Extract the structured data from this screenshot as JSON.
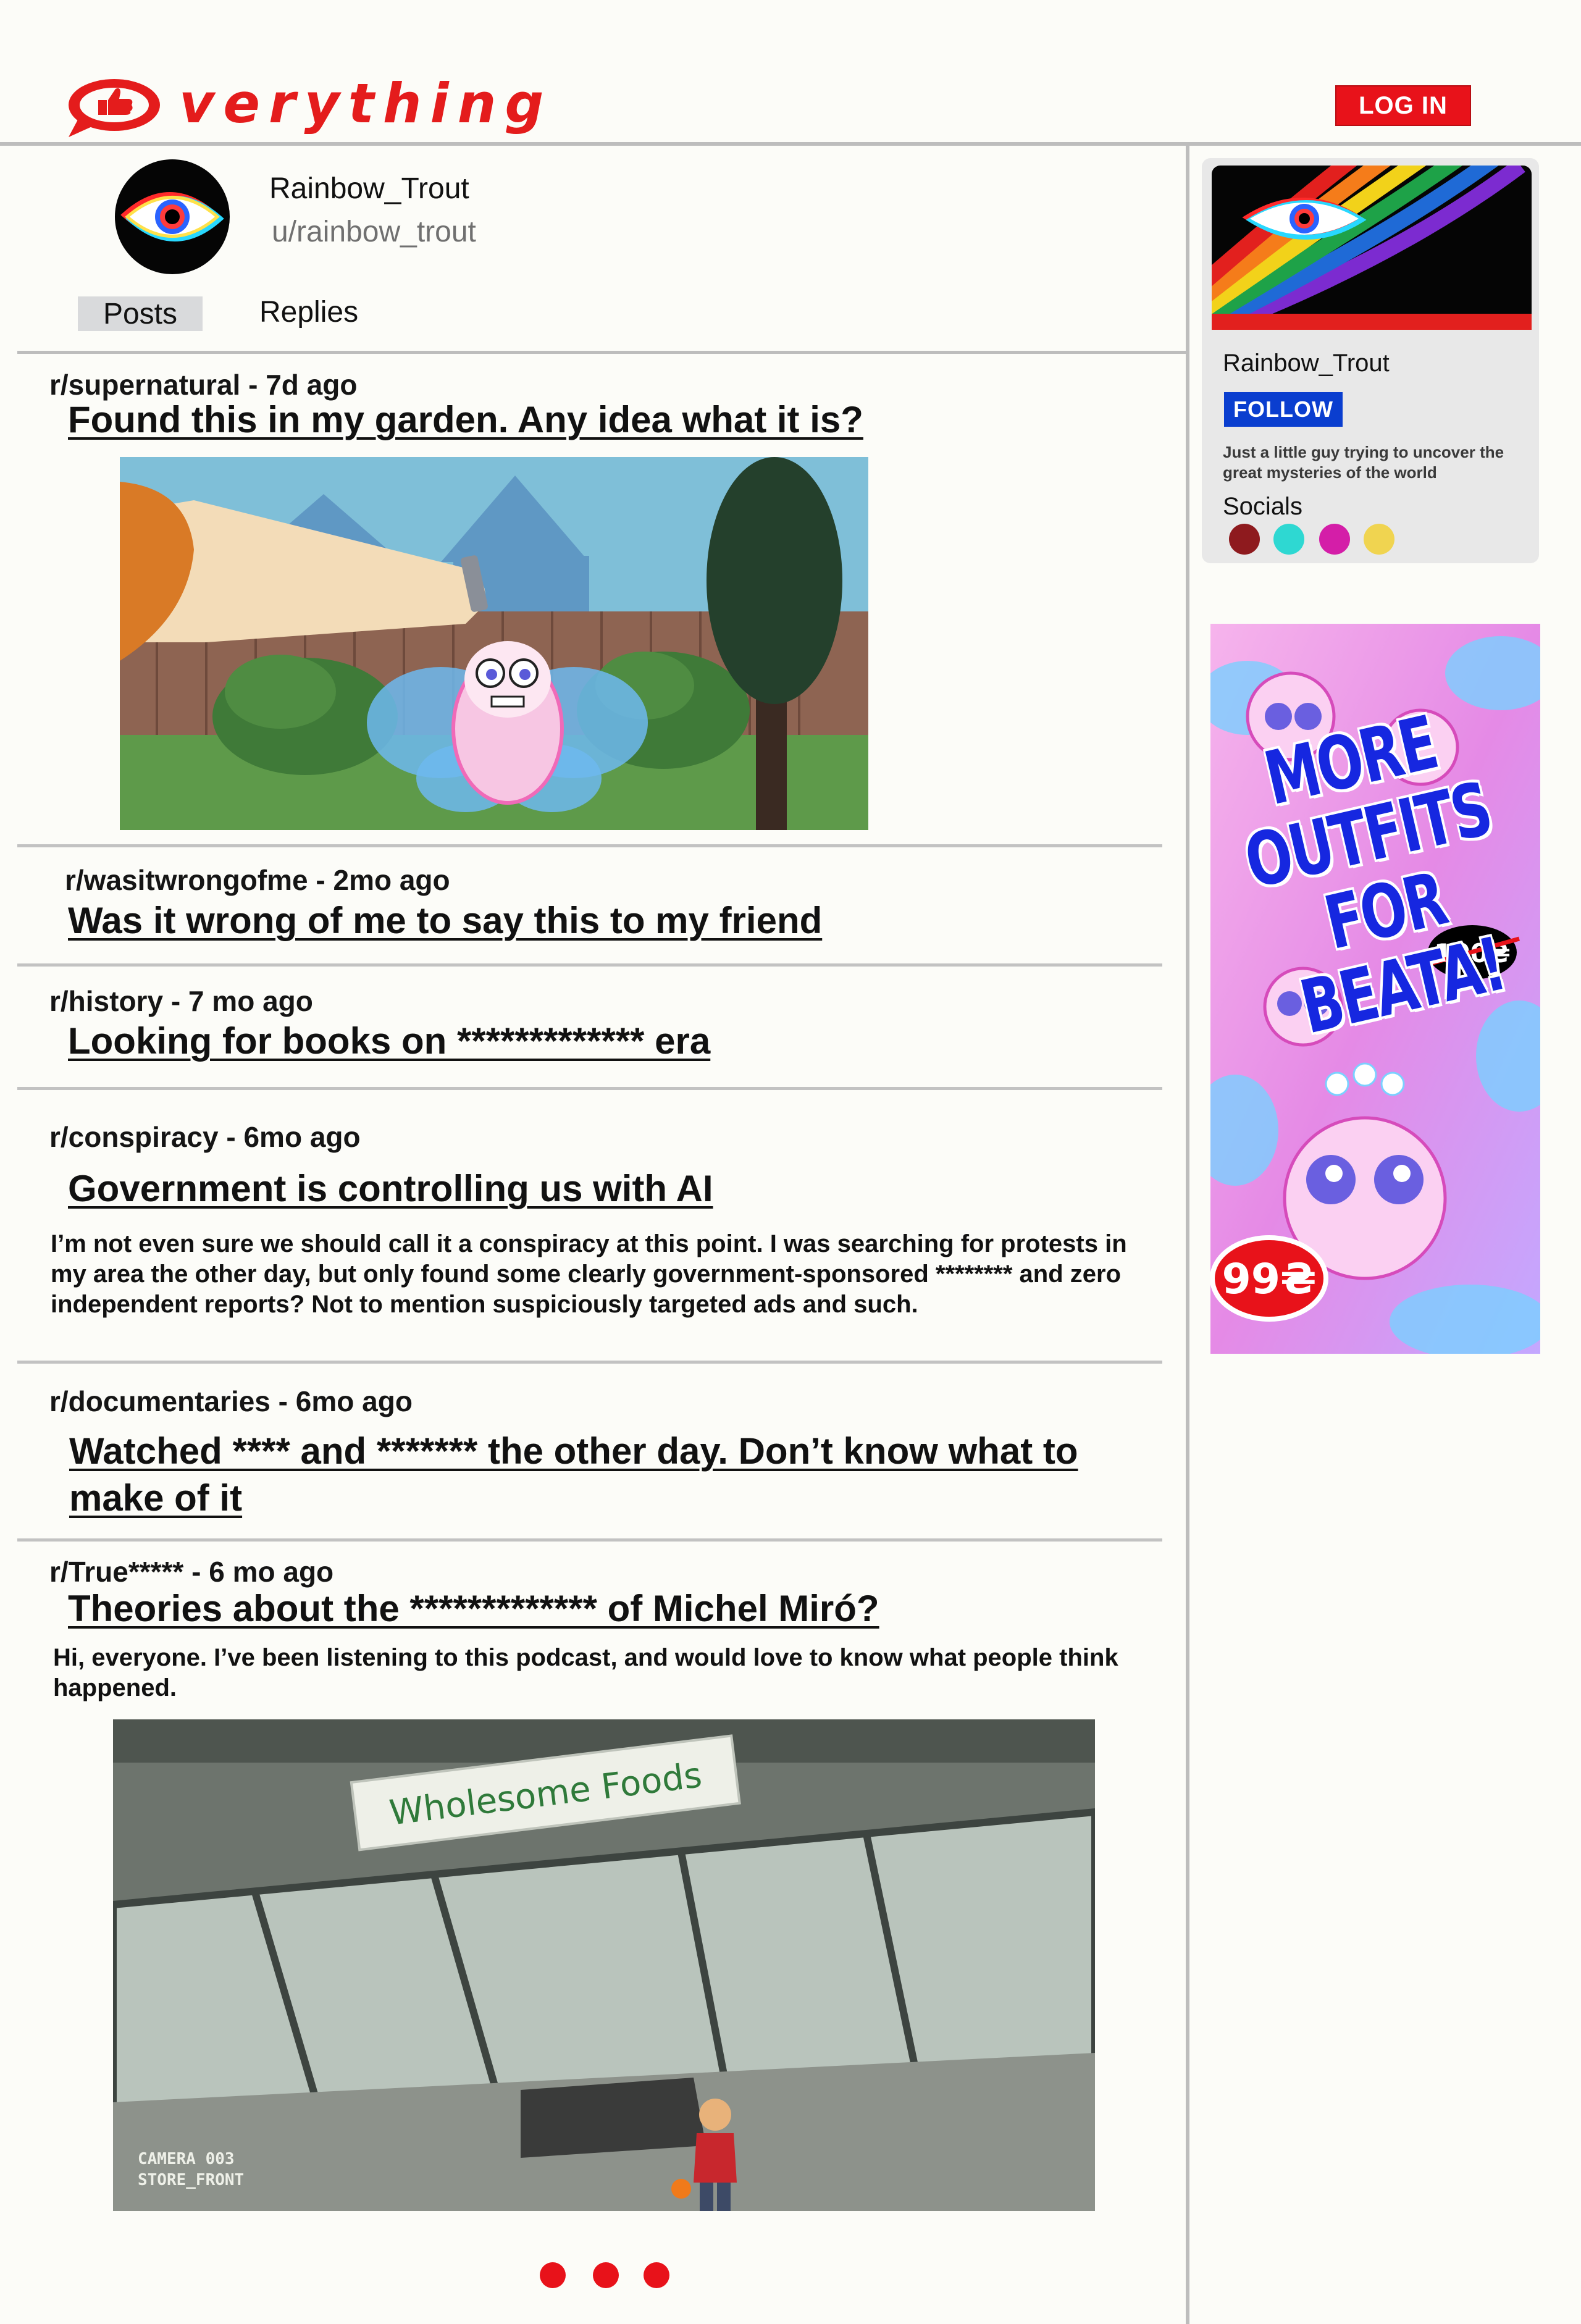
{
  "header": {
    "logo_word": "verything",
    "login_label": "LOG IN"
  },
  "profile": {
    "display_name": "Rainbow_Trout",
    "handle": "u/rainbow_trout",
    "tabs": [
      {
        "label": "Posts",
        "active": true
      },
      {
        "label": "Replies",
        "active": false
      }
    ]
  },
  "posts": [
    {
      "meta": "r/supernatural - 7d ago",
      "title": "Found this in my garden. Any idea what it is?"
    },
    {
      "meta": "r/wasitwrongofme - 2mo ago",
      "title": "Was it wrong of me to say this to my friend"
    },
    {
      "meta": "r/history - 7 mo ago",
      "title": "Looking for books on ************* era"
    },
    {
      "meta": "r/conspiracy - 6mo ago",
      "title": "Government is controlling us with AI",
      "body": "I’m not even sure we should call it a conspiracy at this point. I was searching for protests in my area the other day, but only found some clearly government-sponsored ******** and zero independent reports? Not to mention suspiciously targeted ads and such."
    },
    {
      "meta": "r/documentaries - 6mo ago",
      "title": "Watched **** and ******* the other day. Don’t know what to make of it"
    },
    {
      "meta": "r/True***** - 6 mo ago",
      "title": "Theories about the ************* of Michel Miró?",
      "body": "Hi, everyone. I’ve been listening to this podcast, and would love to know what people think happened."
    }
  ],
  "images": {
    "store_sign": "Wholesome Foods",
    "camera_label": "CAMERA 003",
    "camera_location": "STORE_FRONT"
  },
  "sidebar": {
    "name": "Rainbow_Trout",
    "follow_label": "FOLLOW",
    "bio": "Just a little guy trying to uncover the great mysteries of the world",
    "socials_label": "Socials",
    "social_colors": [
      "#8e1a1e",
      "#2ed8d2",
      "#d41ea8",
      "#f0d450"
    ]
  },
  "ad": {
    "headline": "MORE OUTFITS FOR BEATA!",
    "old_price": "100₴",
    "price": "99₴"
  },
  "pagination": {
    "dots": 3,
    "color": "#e8121a"
  }
}
